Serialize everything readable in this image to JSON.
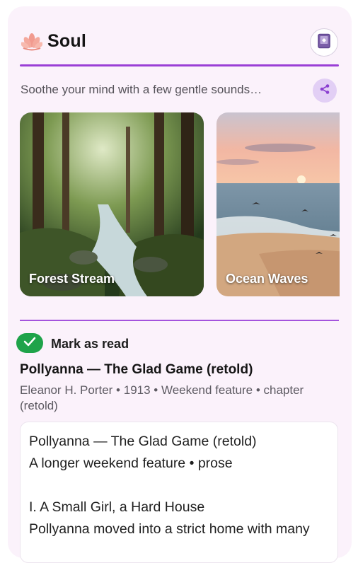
{
  "header": {
    "title": "Soul",
    "logo_icon": "lotus-icon",
    "action_icon": "book-icon"
  },
  "intro": {
    "subtitle": "Soothe your mind with a few gentle sounds…",
    "share_icon": "share-icon"
  },
  "sounds": [
    {
      "label": "Forest Stream",
      "image": "forest-stream-image"
    },
    {
      "label": "Ocean Waves",
      "image": "ocean-waves-image"
    }
  ],
  "read_status": {
    "label": "Mark as read",
    "checked": true,
    "color": "#1fa34a"
  },
  "story": {
    "title": "Pollyanna — The Glad Game (retold)",
    "meta": "Eleanor H. Porter • 1913 • Weekend feature • chapter (retold)",
    "lines": [
      "Pollyanna — The Glad Game (retold)",
      "A longer weekend feature • prose",
      "",
      "I. A Small Girl, a Hard House",
      "Pollyanna moved into a strict home with many"
    ]
  },
  "colors": {
    "accent": "#9a3fd6",
    "card_bg": "#fbf2fb"
  }
}
